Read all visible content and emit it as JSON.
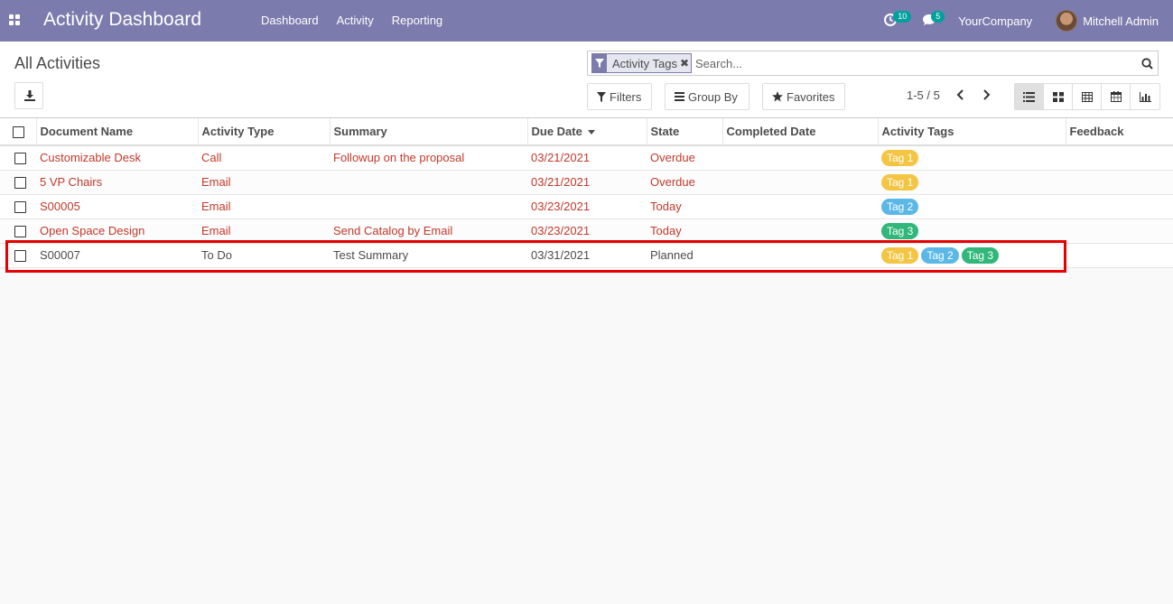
{
  "navbar": {
    "app_title": "Activity Dashboard",
    "menu": [
      "Dashboard",
      "Activity",
      "Reporting"
    ],
    "activity_badge": "10",
    "message_badge": "5",
    "company": "YourCompany",
    "user": "Mitchell Admin",
    "color": "#7c7bad"
  },
  "control_panel": {
    "title": "All Activities",
    "facet_label": "Activity Tags",
    "search_placeholder": "Search...",
    "filters_label": "Filters",
    "groupby_label": "Group By",
    "favorites_label": "Favorites",
    "pager": "1-5 / 5",
    "views": [
      "list-icon",
      "kanban-icon",
      "pivot-icon",
      "calendar-icon",
      "graph-icon"
    ],
    "active_view": "list-icon"
  },
  "table": {
    "columns": [
      "Document Name",
      "Activity Type",
      "Summary",
      "Due Date",
      "State",
      "Completed Date",
      "Activity Tags",
      "Feedback"
    ],
    "sorted_column": "Due Date",
    "rows": [
      {
        "document": "Customizable Desk",
        "type": "Call",
        "summary": "Followup on the proposal",
        "due": "03/21/2021",
        "state": "Overdue",
        "completed": "",
        "tags": [
          "Tag 1"
        ],
        "feedback": "",
        "status": "overdue"
      },
      {
        "document": "5 VP Chairs",
        "type": "Email",
        "summary": "",
        "due": "03/21/2021",
        "state": "Overdue",
        "completed": "",
        "tags": [
          "Tag 1"
        ],
        "feedback": "",
        "status": "overdue"
      },
      {
        "document": "S00005",
        "type": "Email",
        "summary": "",
        "due": "03/23/2021",
        "state": "Today",
        "completed": "",
        "tags": [
          "Tag 2"
        ],
        "feedback": "",
        "status": "today"
      },
      {
        "document": "Open Space Design",
        "type": "Email",
        "summary": "Send Catalog by Email",
        "due": "03/23/2021",
        "state": "Today",
        "completed": "",
        "tags": [
          "Tag 3"
        ],
        "feedback": "",
        "status": "today"
      },
      {
        "document": "S00007",
        "type": "To Do",
        "summary": "Test Summary",
        "due": "03/31/2021",
        "state": "Planned",
        "completed": "",
        "tags": [
          "Tag 1",
          "Tag 2",
          "Tag 3"
        ],
        "feedback": "",
        "status": "planned"
      }
    ]
  },
  "tag_colors": {
    "Tag 1": "#f4c542",
    "Tag 2": "#5bb8e6",
    "Tag 3": "#30b779"
  },
  "highlight_color": "#e60000"
}
